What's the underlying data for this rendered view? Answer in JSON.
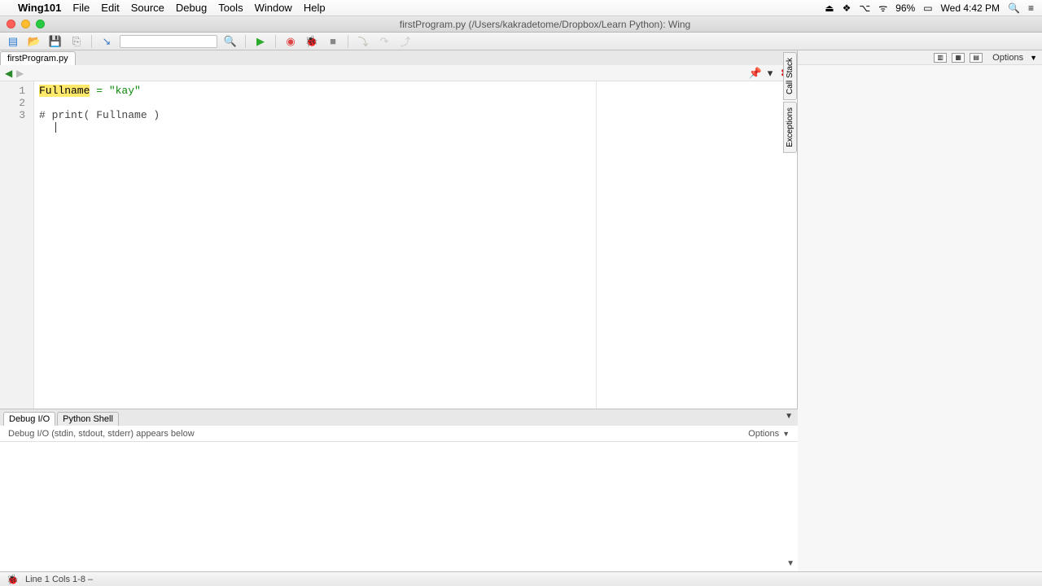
{
  "menubar": {
    "app_name": "Wing101",
    "items": [
      "File",
      "Edit",
      "Source",
      "Debug",
      "Tools",
      "Window",
      "Help"
    ],
    "battery": "96%",
    "clock": "Wed 4:42 PM"
  },
  "window": {
    "title": "firstProgram.py (/Users/kakradetome/Dropbox/Learn Python): Wing"
  },
  "file_tab": "firstProgram.py",
  "code": {
    "line1_var": "Fullname",
    "line1_rest": " = \"kay\"",
    "line3": "# print( Fullname )"
  },
  "gutter": [
    "1",
    "2",
    "3"
  ],
  "side": {
    "vtab1": "Call Stack",
    "vtab2": "Exceptions",
    "options": "Options"
  },
  "bottom": {
    "tab1": "Debug I/O",
    "tab2": "Python Shell",
    "desc": "Debug I/O (stdin, stdout, stderr) appears below",
    "options": "Options"
  },
  "status": {
    "text": "Line 1 Cols 1-8 –"
  }
}
